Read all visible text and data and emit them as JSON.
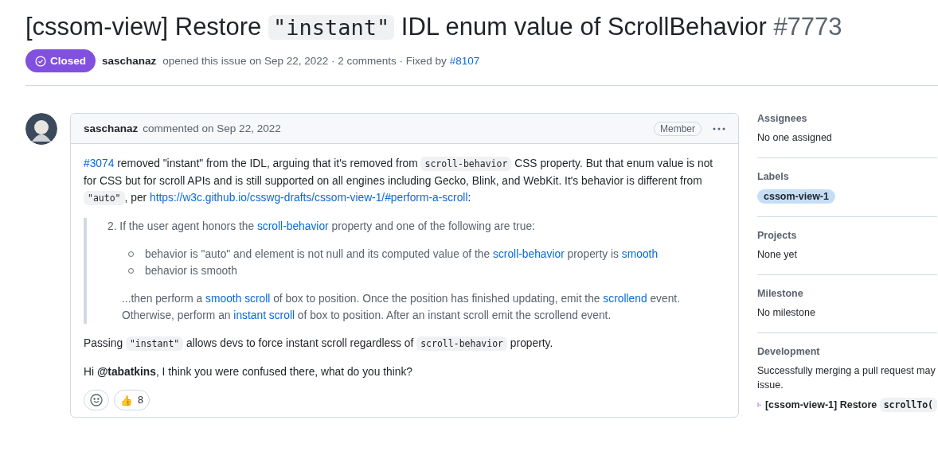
{
  "title": {
    "segments": [
      {
        "kind": "text",
        "text": "[cssom-view] Restore "
      },
      {
        "kind": "code",
        "text": "\"instant\""
      },
      {
        "kind": "text",
        "text": " IDL enum value of ScrollBehavior"
      }
    ],
    "number": "#7773"
  },
  "meta": {
    "state": {
      "label": "Closed",
      "kind": "closed"
    },
    "author": "saschanaz",
    "opened": "opened this issue on Sep 22, 2022 · 2 comments · Fixed by",
    "fixed_by": "#8107"
  },
  "comment": {
    "author": "saschanaz",
    "date": "commented on Sep 22, 2022",
    "role": "Member",
    "body": [
      {
        "kind": "paragraph",
        "segments": [
          {
            "kind": "link",
            "text": "#3074"
          },
          {
            "kind": "text",
            "text": " removed \"instant\" from the IDL, arguing that it's removed from "
          },
          {
            "kind": "code",
            "text": "scroll-behavior"
          },
          {
            "kind": "text",
            "text": " CSS property. But that enum value is not for CSS but for scroll APIs and is still supported on all engines including Gecko, Blink, and WebKit. It's behavior is different from "
          },
          {
            "kind": "code",
            "text": "\"auto\""
          },
          {
            "kind": "text",
            "text": ", per "
          },
          {
            "kind": "link",
            "text": "https://w3c.github.io/csswg-drafts/cssom-view-1/#perform-a-scroll"
          },
          {
            "kind": "text",
            "text": ":"
          }
        ]
      },
      {
        "kind": "quote",
        "number": "2.",
        "intro": [
          {
            "kind": "text",
            "text": "If the user agent honors the "
          },
          {
            "kind": "link",
            "text": "scroll-behavior"
          },
          {
            "kind": "text",
            "text": " property and one of the following are true:"
          }
        ],
        "bullets": [
          [
            {
              "kind": "text",
              "text": "behavior is \"auto\" and element is not null and its computed value of the "
            },
            {
              "kind": "link",
              "text": "scroll-behavior"
            },
            {
              "kind": "text",
              "text": " property is "
            },
            {
              "kind": "link",
              "text": "smooth"
            }
          ],
          [
            {
              "kind": "text",
              "text": "behavior is smooth"
            }
          ]
        ],
        "outro": [
          {
            "kind": "text",
            "text": "...then perform a "
          },
          {
            "kind": "link",
            "text": "smooth scroll"
          },
          {
            "kind": "text",
            "text": " of box to position. Once the position has finished updating, emit the "
          },
          {
            "kind": "link",
            "text": "scrollend"
          },
          {
            "kind": "text",
            "text": " event. Otherwise, perform an "
          },
          {
            "kind": "link",
            "text": "instant scroll"
          },
          {
            "kind": "text",
            "text": " of box to position. After an instant scroll emit the scrollend event."
          }
        ]
      },
      {
        "kind": "paragraph",
        "segments": [
          {
            "kind": "text",
            "text": "Passing "
          },
          {
            "kind": "code",
            "text": "\"instant\""
          },
          {
            "kind": "text",
            "text": " allows devs to force instant scroll regardless of "
          },
          {
            "kind": "code",
            "text": "scroll-behavior"
          },
          {
            "kind": "text",
            "text": " property."
          }
        ]
      },
      {
        "kind": "paragraph",
        "segments": [
          {
            "kind": "text",
            "text": "Hi **@tabatkins**, I think you were confused there, what do you think?"
          }
        ]
      }
    ],
    "reactions": [
      {
        "emoji": "👍",
        "count": "8"
      }
    ]
  },
  "sidebar": [
    {
      "heading": "Assignees",
      "kind": "text",
      "text": "No one assigned"
    },
    {
      "heading": "Labels",
      "kind": "labels",
      "labels": [
        {
          "text": "cssom-view-1",
          "color": "#c5def5"
        }
      ]
    },
    {
      "heading": "Projects",
      "kind": "text",
      "text": "None yet"
    },
    {
      "heading": "Milestone",
      "kind": "text",
      "text": "No milestone"
    },
    {
      "heading": "Development",
      "kind": "development",
      "lines": [
        "Successfully merging a pull request may",
        "issue."
      ],
      "pr": {
        "text": "[cssom-view-1] Restore ",
        "code": "scrollTo("
      }
    }
  ]
}
